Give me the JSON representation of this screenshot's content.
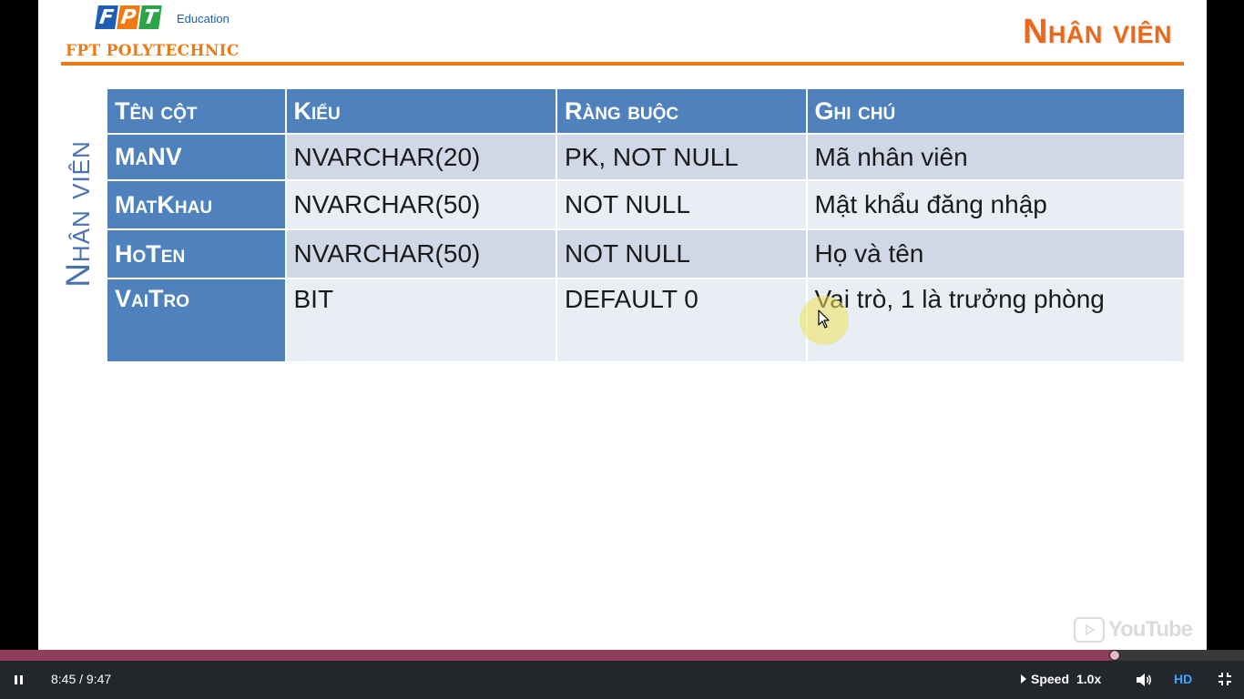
{
  "logo": {
    "letters": [
      "F",
      "P",
      "T"
    ],
    "education": "Education",
    "polytechnic": "FPT POLYTECHNIC"
  },
  "slide": {
    "title": "Nhân viên",
    "side_label": "Nhân viên",
    "table": {
      "headers": [
        "Tên cột",
        "Kiểu",
        "Ràng buộc",
        "Ghi chú"
      ],
      "rows": [
        [
          "MaNV",
          "NVARCHAR(20)",
          "PK, NOT NULL",
          "Mã nhân viên"
        ],
        [
          "MatKhau",
          "NVARCHAR(50)",
          "NOT NULL",
          "Mật khẩu đăng nhập"
        ],
        [
          "HoTen",
          "NVARCHAR(50)",
          "NOT NULL",
          "Họ và tên"
        ],
        [
          "VaiTro",
          "BIT",
          "DEFAULT 0",
          "Vai trò, 1 là trưởng phòng"
        ]
      ]
    }
  },
  "watermark": {
    "text": "YouTube",
    "icon": "youtube-logo-icon"
  },
  "player": {
    "progress_fraction": 0.8963,
    "time": "8:45 / 9:47",
    "speed_label": "Speed",
    "speed_value": "1.0x",
    "quality": "HD",
    "icons": {
      "play_state": "pause-icon",
      "volume": "volume-icon",
      "fullscreen": "exit-fullscreen-icon"
    }
  },
  "colors": {
    "accent_orange": "#f07a12",
    "header_blue": "#4f81bd",
    "row_odd": "#d0d8e8",
    "row_even": "#e9edf4",
    "progress": "#8f3f5c",
    "hd": "#3ea6ff"
  }
}
